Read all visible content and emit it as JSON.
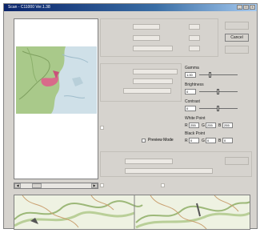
{
  "window": {
    "title": "Scan - C11000 Ver.1.38",
    "min_label": "_",
    "max_label": "□",
    "close_label": "×"
  },
  "buttons": {
    "top": "",
    "cancel": "Cancel",
    "third": "",
    "right_lower": ""
  },
  "adjust": {
    "gamma_label": "Gamma",
    "gamma_value": "1.00",
    "brightness_label": "Brightness",
    "brightness_value": "0",
    "contrast_label": "Contrast",
    "contrast_value": "0",
    "white_point_label": "White Point",
    "white_point": {
      "r_label": "R",
      "r": "255",
      "g_label": "G",
      "g": "255",
      "b_label": "B",
      "b": "255"
    },
    "black_point_label": "Black Point",
    "black_point": {
      "r_label": "R",
      "r": "0",
      "g_label": "G",
      "g": "0",
      "b_label": "B",
      "b": "0"
    }
  },
  "preview_mode_label": "Preview Mode",
  "scroll": {
    "left": "◀",
    "right": "▶"
  }
}
